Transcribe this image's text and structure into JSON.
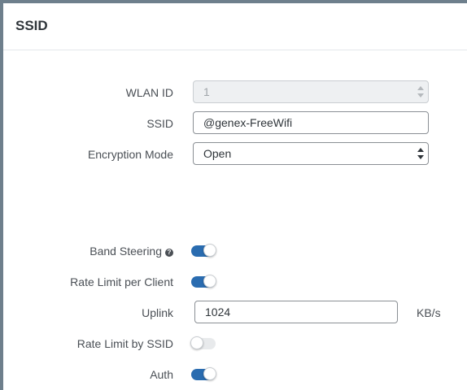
{
  "panel": {
    "title": "SSID"
  },
  "form": {
    "wlan_id": {
      "label": "WLAN ID",
      "value": "1",
      "disabled": true
    },
    "ssid": {
      "label": "SSID",
      "value": "@genex-FreeWifi"
    },
    "encryption_mode": {
      "label": "Encryption Mode",
      "selected": "Open"
    },
    "band_steering": {
      "label": "Band Steering",
      "on": true,
      "help_icon": "question-circle-icon"
    },
    "rate_limit_per_client": {
      "label": "Rate Limit per Client",
      "on": true
    },
    "uplink": {
      "label": "Uplink",
      "value": "1024",
      "unit": "KB/s"
    },
    "rate_limit_by_ssid": {
      "label": "Rate Limit by SSID",
      "on": false
    },
    "auth": {
      "label": "Auth",
      "on": true
    }
  },
  "colors": {
    "toggle_on": "#2a6cb0",
    "toggle_off": "#e8eaec",
    "frame": "#6e7f8c"
  }
}
